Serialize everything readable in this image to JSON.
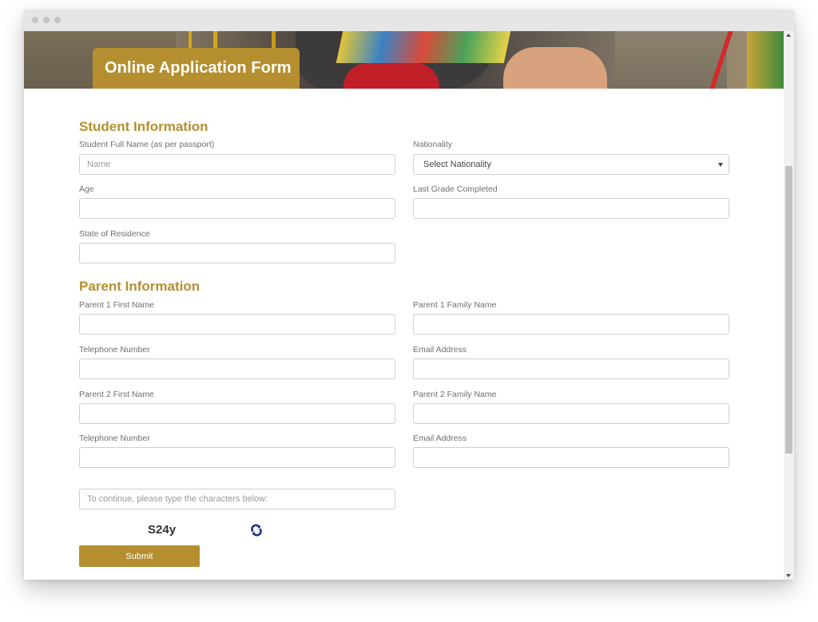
{
  "header": {
    "title": "Online Application Form"
  },
  "student": {
    "section_title": "Student Information",
    "full_name_label": "Student Full Name (as per passport)",
    "full_name_placeholder": "Name",
    "nationality_label": "Nationality",
    "nationality_selected": "Select Nationality",
    "age_label": "Age",
    "last_grade_label": "Last Grade Completed",
    "state_label": "State of Residence"
  },
  "parent": {
    "section_title": "Parent Information",
    "p1_first_label": "Parent 1 First Name",
    "p1_family_label": "Parent 1 Family Name",
    "p1_phone_label": "Telephone Number",
    "p1_email_label": "Email Address",
    "p2_first_label": "Parent 2 First Name",
    "p2_family_label": "Parent 2 Family Name",
    "p2_phone_label": "Telephone Number",
    "p2_email_label": "Email Address"
  },
  "captcha": {
    "placeholder": "To continue, please type the characters below:",
    "code": "S24y",
    "refresh_icon": "refresh-icon"
  },
  "form": {
    "submit_label": "Submit"
  },
  "colors": {
    "accent": "#b58f2f",
    "refresh_icon": "#1c2f8a"
  }
}
